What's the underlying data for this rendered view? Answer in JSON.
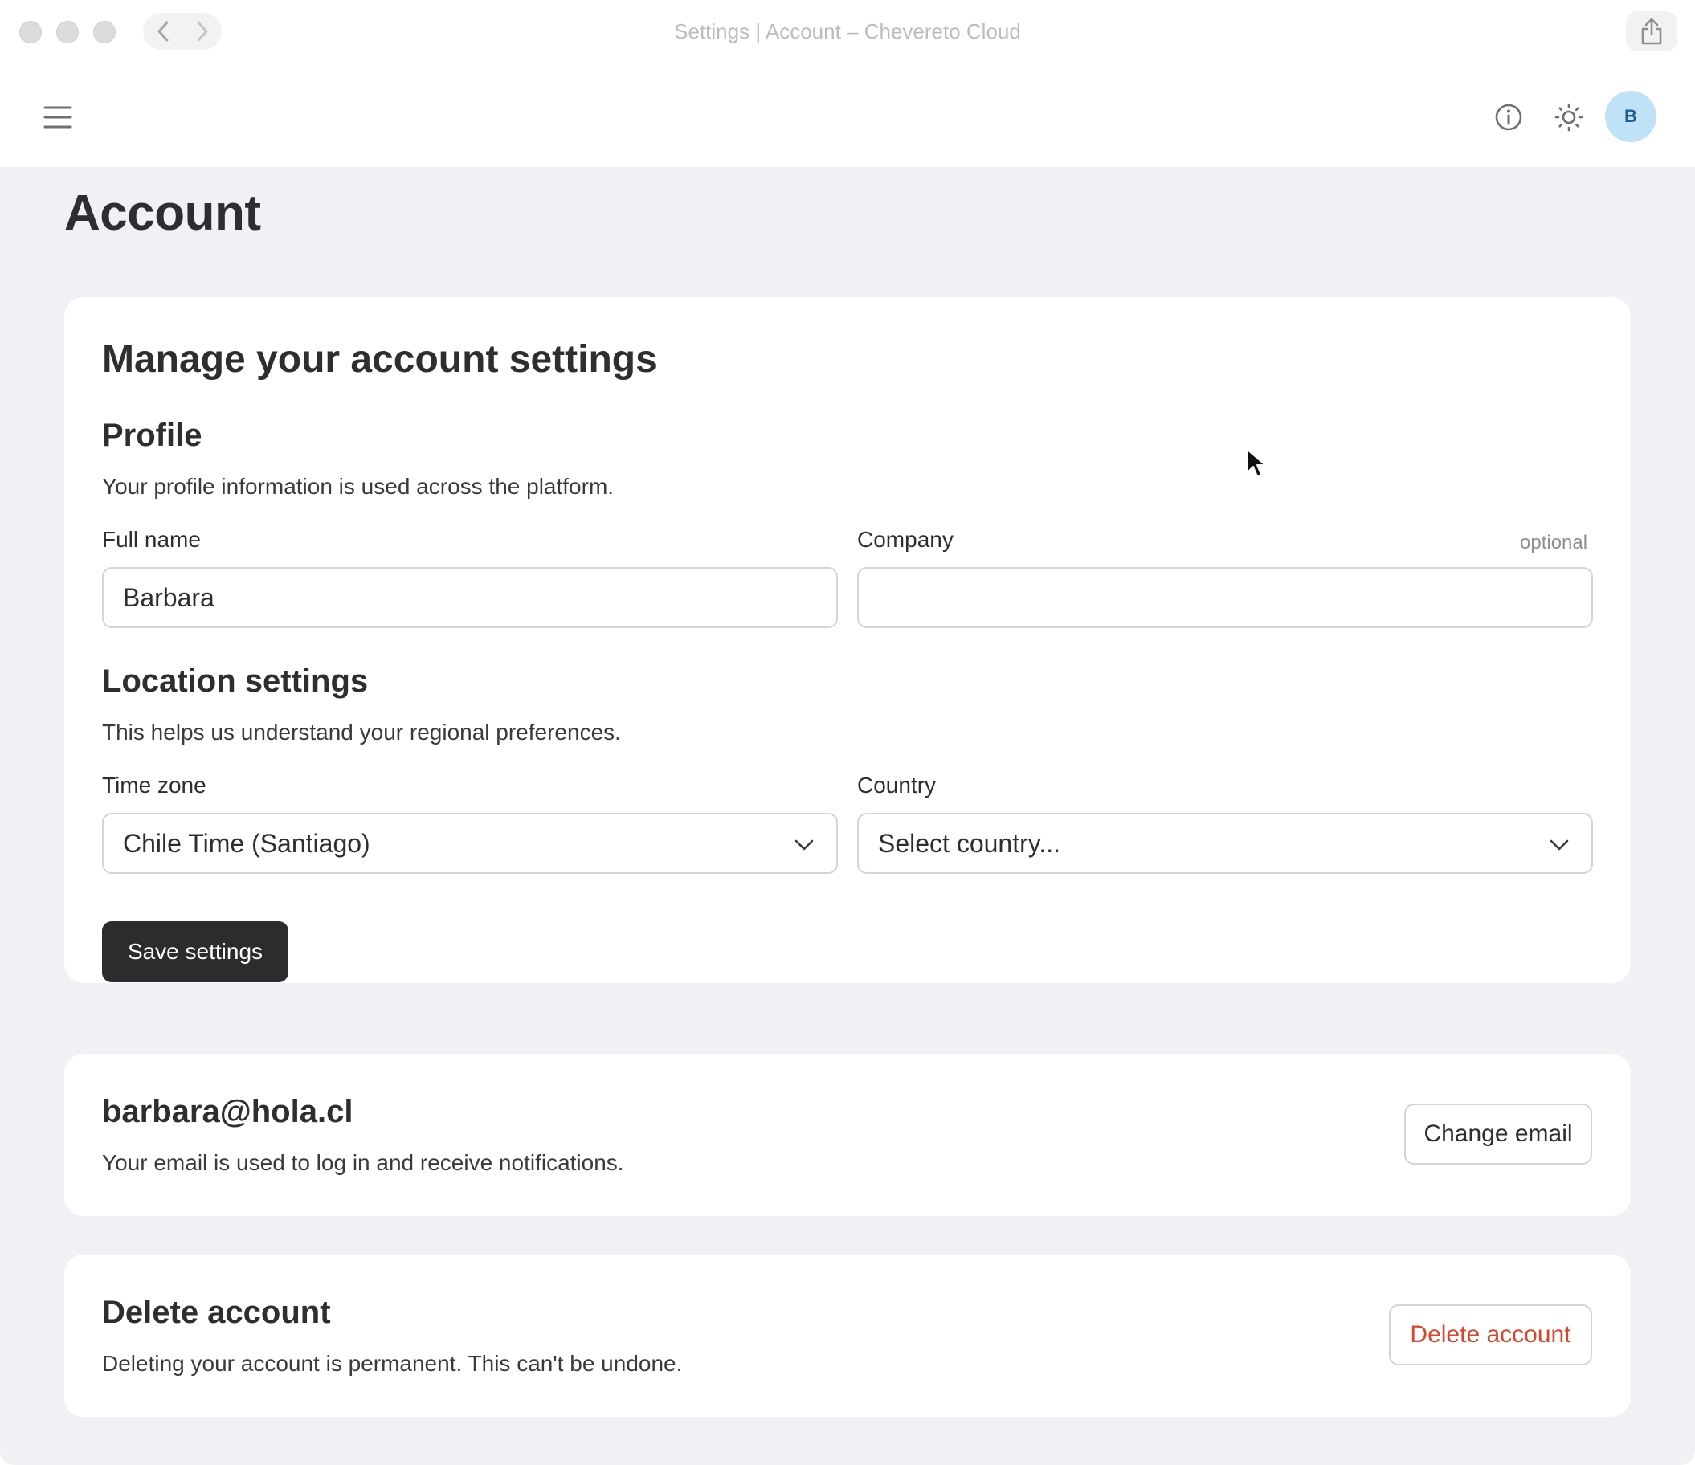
{
  "window": {
    "title": "Settings | Account – Chevereto Cloud"
  },
  "header": {
    "avatar_initial": "B"
  },
  "page": {
    "title": "Account"
  },
  "settings_card": {
    "heading": "Manage your account settings",
    "profile": {
      "heading": "Profile",
      "description": "Your profile information is used across the platform.",
      "full_name_label": "Full name",
      "full_name_value": "Barbara",
      "company_label": "Company",
      "company_optional": "optional",
      "company_value": ""
    },
    "location": {
      "heading": "Location settings",
      "description": "This helps us understand your regional preferences.",
      "timezone_label": "Time zone",
      "timezone_value": "Chile Time (Santiago)",
      "country_label": "Country",
      "country_value": "Select country..."
    },
    "save_label": "Save settings"
  },
  "email_card": {
    "email": "barbara@hola.cl",
    "description": "Your email is used to log in and receive notifications.",
    "button_label": "Change email"
  },
  "delete_card": {
    "heading": "Delete account",
    "description": "Deleting your account is permanent. This can't be undone.",
    "button_label": "Delete account"
  },
  "colors": {
    "accent_dark": "#2c2c2e",
    "danger": "#d6462f",
    "background": "#f1f1f5",
    "avatar": "#bfe2f7"
  }
}
